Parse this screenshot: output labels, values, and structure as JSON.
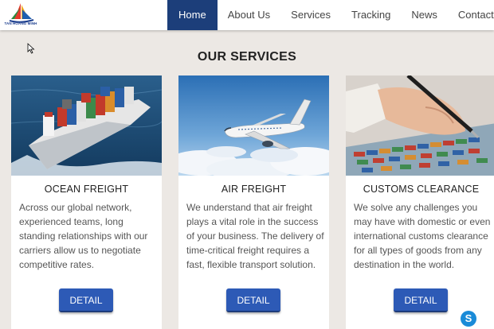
{
  "header": {
    "logo_text": "TAN HOANG MINH",
    "nav": [
      {
        "label": "Home",
        "active": true
      },
      {
        "label": "About Us",
        "active": false
      },
      {
        "label": "Services",
        "active": false
      },
      {
        "label": "Tracking",
        "active": false
      },
      {
        "label": "News",
        "active": false
      },
      {
        "label": "Contact Us",
        "active": false
      }
    ]
  },
  "main": {
    "title": "OUR SERVICES",
    "cards": [
      {
        "title": "OCEAN FREIGHT",
        "text": "Across our global network, experienced teams, long standing relationships with our carriers allow us to negotiate competitive rates.",
        "button": "DETAIL"
      },
      {
        "title": "AIR FREIGHT",
        "text": "We understand that air freight plays a vital role in the success of your business. The delivery of time-critical freight requires a fast, flexible transport solution.",
        "button": "DETAIL"
      },
      {
        "title": "CUSTOMS CLEARANCE",
        "text": "We solve any challenges you may have with domestic or even international customs clearance for all types of goods from any destination in the world.",
        "button": "DETAIL"
      }
    ]
  },
  "colors": {
    "nav_active": "#1c3e7a",
    "button": "#2d5ab6",
    "background": "#ece8e4"
  },
  "icons": {
    "chat": "skype-icon"
  }
}
